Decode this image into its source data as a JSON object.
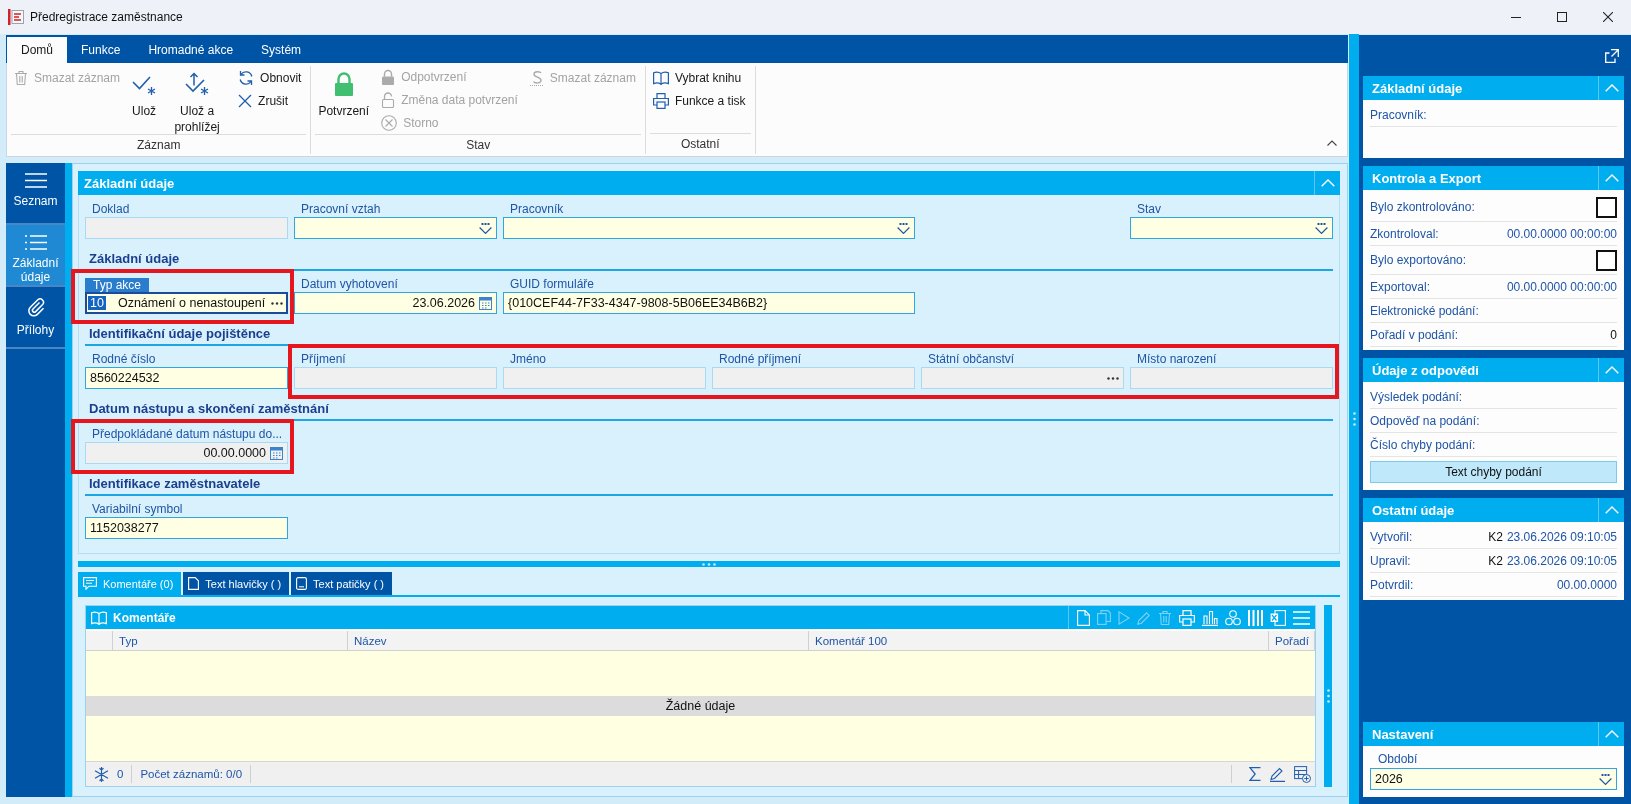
{
  "window": {
    "title": "Předregistrace zaměstnance"
  },
  "ribbon": {
    "tabs": [
      {
        "label": "Domů",
        "selected": true
      },
      {
        "label": "Funkce",
        "selected": false
      },
      {
        "label": "Hromadné akce",
        "selected": false
      },
      {
        "label": "Systém",
        "selected": false
      }
    ],
    "groups": [
      {
        "label": "Záznam",
        "columns": [
          {
            "kind": "stack",
            "items": [
              {
                "label": "Smazat záznam",
                "disabled": true
              }
            ]
          },
          {
            "kind": "large",
            "items": [
              {
                "label": "Ulož",
                "disabled": false
              }
            ]
          },
          {
            "kind": "large",
            "items": [
              {
                "label": "Ulož a prohlížej",
                "disabled": false
              }
            ]
          },
          {
            "kind": "stack",
            "items": [
              {
                "label": "Obnovit",
                "disabled": false
              },
              {
                "label": "Zrušit",
                "disabled": false
              }
            ]
          }
        ]
      },
      {
        "label": "Stav",
        "columns": [
          {
            "kind": "large",
            "items": [
              {
                "label": "Potvrzení",
                "disabled": false
              }
            ]
          },
          {
            "kind": "stack",
            "items": [
              {
                "label": "Odpotvrzení",
                "disabled": true
              },
              {
                "label": "Změna data potvrzení",
                "disabled": true
              },
              {
                "label": "Storno",
                "disabled": true
              }
            ]
          },
          {
            "kind": "stack",
            "items": [
              {
                "label": "Smazat záznam",
                "disabled": true
              }
            ]
          }
        ]
      },
      {
        "label": "Ostatní",
        "columns": [
          {
            "kind": "stack",
            "items": [
              {
                "label": "Vybrat knihu",
                "disabled": false
              },
              {
                "label": "Funkce a tisk",
                "disabled": false
              }
            ]
          }
        ]
      }
    ]
  },
  "nav": {
    "items": [
      {
        "label": "Seznam",
        "selected": false
      },
      {
        "label": "Základní údaje",
        "selected": true
      },
      {
        "label": "Přílohy",
        "selected": false
      }
    ]
  },
  "form": {
    "title": "Základní údaje",
    "expanded": true,
    "sections": [
      {
        "groups": [
          {
            "highlighted": false,
            "fields": [
              {
                "label": "Doklad",
                "kind": "text",
                "disabled": true,
                "focused": false
              },
              {
                "label": "Pracovní vztah",
                "kind": "dropdown",
                "disabled": false,
                "focused": false
              },
              {
                "label": "Pracovník",
                "kind": "dropdown",
                "disabled": false,
                "focused": false
              },
              {
                "label": "Stav",
                "kind": "dropdown",
                "disabled": false,
                "focused": false
              }
            ]
          }
        ]
      },
      {
        "title": "Základní údaje",
        "groups": [
          {
            "highlighted": true,
            "fields": [
              {
                "label": "Typ akce",
                "kind": "lookup",
                "code": "10",
                "value": "Oznámení o nenastoupení",
                "disabled": false,
                "focused": true
              }
            ]
          },
          {
            "highlighted": false,
            "fields": [
              {
                "label": "Datum vyhotovení",
                "kind": "date",
                "value": "23.06.2026",
                "disabled": false,
                "focused": false
              },
              {
                "label": "GUID formuláře",
                "kind": "text",
                "value": "{010CEF44-7F33-4347-9808-5B06EE34B6B2}",
                "disabled": false,
                "focused": false
              }
            ]
          }
        ]
      },
      {
        "title": "Identifikační údaje pojištěnce",
        "groups": [
          {
            "highlighted": false,
            "fields": [
              {
                "label": "Rodné číslo",
                "kind": "text",
                "value": "8560224532",
                "disabled": false,
                "focused": false
              }
            ]
          },
          {
            "highlighted": true,
            "fields": [
              {
                "label": "Příjmení",
                "kind": "text",
                "disabled": true,
                "focused": false
              },
              {
                "label": "Jméno",
                "kind": "text",
                "disabled": true,
                "focused": false
              },
              {
                "label": "Rodné příjmení",
                "kind": "text",
                "disabled": true,
                "focused": false
              },
              {
                "label": "Státní občanství",
                "kind": "lookup",
                "disabled": true,
                "focused": false
              },
              {
                "label": "Místo narození",
                "kind": "text",
                "disabled": true,
                "focused": false
              }
            ]
          }
        ]
      },
      {
        "title": "Datum nástupu a skončení zaměstnání",
        "groups": [
          {
            "highlighted": true,
            "fields": [
              {
                "label": "Předpokládané datum nástupu do...",
                "kind": "date",
                "value": "00.00.0000",
                "disabled": true,
                "focused": false
              }
            ]
          }
        ]
      },
      {
        "title": "Identifikace zaměstnavatele",
        "groups": [
          {
            "highlighted": false,
            "fields": [
              {
                "label": "Variabilní symbol",
                "kind": "text",
                "value": "1152038277",
                "disabled": false,
                "focused": false
              }
            ]
          }
        ]
      }
    ]
  },
  "detail_tabs": [
    {
      "label": "Komentáře (0)",
      "selected": true
    },
    {
      "label": "Text hlavičky ( )",
      "selected": false
    },
    {
      "label": "Text patičky ( )",
      "selected": false
    }
  ],
  "grid": {
    "title": "Komentáře",
    "toolbar": [
      {
        "disabled": false
      },
      {
        "disabled": true
      },
      {
        "disabled": true
      },
      {
        "disabled": true
      },
      {
        "disabled": true
      },
      {
        "disabled": false
      },
      {
        "disabled": false
      },
      {
        "disabled": false
      },
      {
        "disabled": false
      },
      {
        "disabled": false
      },
      {
        "disabled": false
      }
    ],
    "columns": [
      "Typ",
      "Název",
      "Komentář 100",
      "Pořadí"
    ],
    "empty_text": "Žádné údaje",
    "footer": {
      "count": "0",
      "records": "Počet záznamů: 0/0"
    }
  },
  "side_panel": {
    "sections": [
      {
        "title": "Základní údaje",
        "expanded": true,
        "rows": [
          {
            "kind": "block",
            "label": "Pracovník:"
          }
        ]
      },
      {
        "title": "Kontrola a Export",
        "expanded": true,
        "rows": [
          {
            "kind": "check",
            "label": "Bylo zkontrolováno:",
            "checked": false
          },
          {
            "kind": "text",
            "label": "Zkontroloval:",
            "value": "00.00.0000 00:00:00"
          },
          {
            "kind": "check",
            "label": "Bylo exportováno:",
            "checked": false
          },
          {
            "kind": "text",
            "label": "Exportoval:",
            "value": "00.00.0000 00:00:00"
          },
          {
            "kind": "text",
            "label": "Elektronické podání:"
          },
          {
            "kind": "count",
            "label": "Pořadí v podání:",
            "value": "0"
          }
        ]
      },
      {
        "title": "Údaje z odpovědi",
        "expanded": true,
        "rows": [
          {
            "kind": "text",
            "label": "Výsledek podání:"
          },
          {
            "kind": "text",
            "label": "Odpověď na podání:"
          },
          {
            "kind": "text",
            "label": "Číslo chyby podání:"
          },
          {
            "kind": "button",
            "label": "Text chyby podání"
          }
        ]
      },
      {
        "title": "Ostatní údaje",
        "expanded": true,
        "rows": [
          {
            "kind": "text",
            "label": "Vytvořil:",
            "user": "K2",
            "value": "23.06.2026 09:10:05"
          },
          {
            "kind": "text",
            "label": "Upravil:",
            "user": "K2",
            "value": "23.06.2026 09:10:05"
          },
          {
            "kind": "text",
            "label": "Potvrdil:",
            "value": "00.00.0000"
          }
        ]
      }
    ],
    "settings": {
      "title": "Nastavení",
      "expanded": true,
      "field": {
        "label": "Období",
        "value": "2026"
      }
    }
  }
}
